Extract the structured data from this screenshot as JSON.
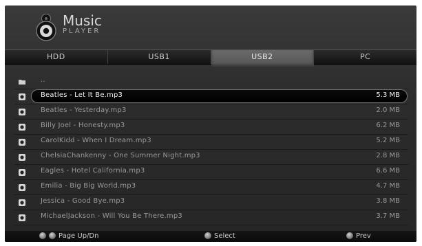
{
  "brand": {
    "title": "Music",
    "subtitle": "PLAYER"
  },
  "tabs": [
    {
      "label": "HDD",
      "active": false
    },
    {
      "label": "USB1",
      "active": false
    },
    {
      "label": "USB2",
      "active": true
    },
    {
      "label": "PC",
      "active": false
    }
  ],
  "list": {
    "parent_label": "..",
    "items": [
      {
        "name": "Beatles - Let It Be.mp3",
        "size": "5.3 MB",
        "selected": true
      },
      {
        "name": "Beatles - Yesterday.mp3",
        "size": "2.0 MB"
      },
      {
        "name": "Billy Joel - Honesty.mp3",
        "size": "6.2 MB"
      },
      {
        "name": "CarolKidd - When I Dream.mp3",
        "size": "5.2 MB"
      },
      {
        "name": "ChelsiaChankenny - One Summer Night.mp3",
        "size": "2.8 MB"
      },
      {
        "name": "Eagles - Hotel California.mp3",
        "size": "6.6 MB"
      },
      {
        "name": "Emilia - Big Big World.mp3",
        "size": "4.7 MB"
      },
      {
        "name": "Jessica - Good Bye.mp3",
        "size": "3.8 MB"
      },
      {
        "name": "MichaelJackson - Will You Be There.mp3",
        "size": "3.7 MB"
      }
    ]
  },
  "footer": {
    "page_label": "Page Up/Dn",
    "select_label": "Select",
    "prev_label": "Prev"
  }
}
